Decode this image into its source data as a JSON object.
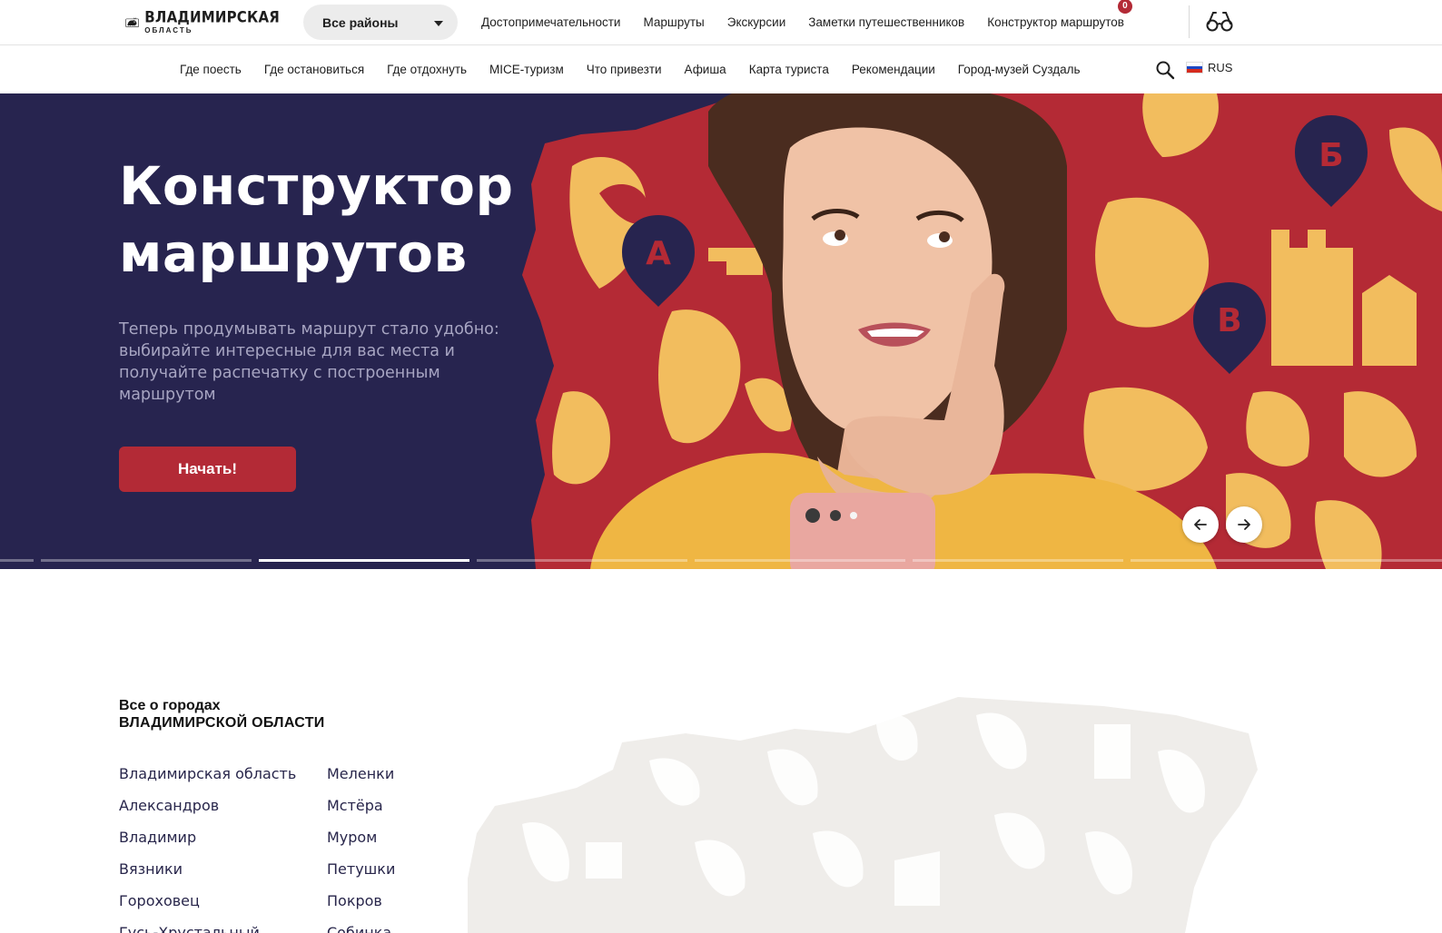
{
  "header": {
    "logo": {
      "title": "ВЛАДИМИРСКАЯ",
      "subtitle": "ОБЛАСТЬ"
    },
    "district_select": {
      "value": "Все районы"
    },
    "nav": [
      {
        "label": "Достопримечательности"
      },
      {
        "label": "Маршруты"
      },
      {
        "label": "Экскурсии"
      },
      {
        "label": "Заметки путешественников"
      },
      {
        "label": "Конструктор маршрутов",
        "badge": "0"
      }
    ],
    "accessibility_icon": "glasses-icon"
  },
  "subnav": {
    "items": [
      {
        "label": "Где поесть"
      },
      {
        "label": "Где остановиться"
      },
      {
        "label": "Где отдохнуть"
      },
      {
        "label": "MICE-туризм"
      },
      {
        "label": "Что привезти"
      },
      {
        "label": "Афиша"
      },
      {
        "label": "Карта туриста"
      },
      {
        "label": "Рекомендации"
      },
      {
        "label": "Город-музей Суздаль"
      }
    ],
    "search_icon": "search-icon",
    "language": "RUS"
  },
  "hero": {
    "title_line1": "Конструктор",
    "title_line2": "маршрутов",
    "description": "Теперь продумывать маршрут стало удобно: выбирайте интересные для вас места и получайте распечатку с построенным маршрутом",
    "button": "Начать!",
    "pins": [
      "А",
      "Б",
      "В"
    ],
    "slides_total": 7,
    "active_slide": 3,
    "colors": {
      "background": "#27244f",
      "accent": "#b32a36",
      "ornament": "#f2bd5e",
      "shirt": "#efb643"
    }
  },
  "cities": {
    "heading_line1": "Все о городах",
    "heading_line2": "ВЛАДИМИРСКОЙ ОБЛАСТИ",
    "col1": [
      "Владимирская область",
      "Александров",
      "Владимир",
      "Вязники",
      "Гороховец",
      "Гусь-Хрустальный"
    ],
    "col2": [
      "Меленки",
      "Мстёра",
      "Муром",
      "Петушки",
      "Покров",
      "Собинка"
    ]
  }
}
